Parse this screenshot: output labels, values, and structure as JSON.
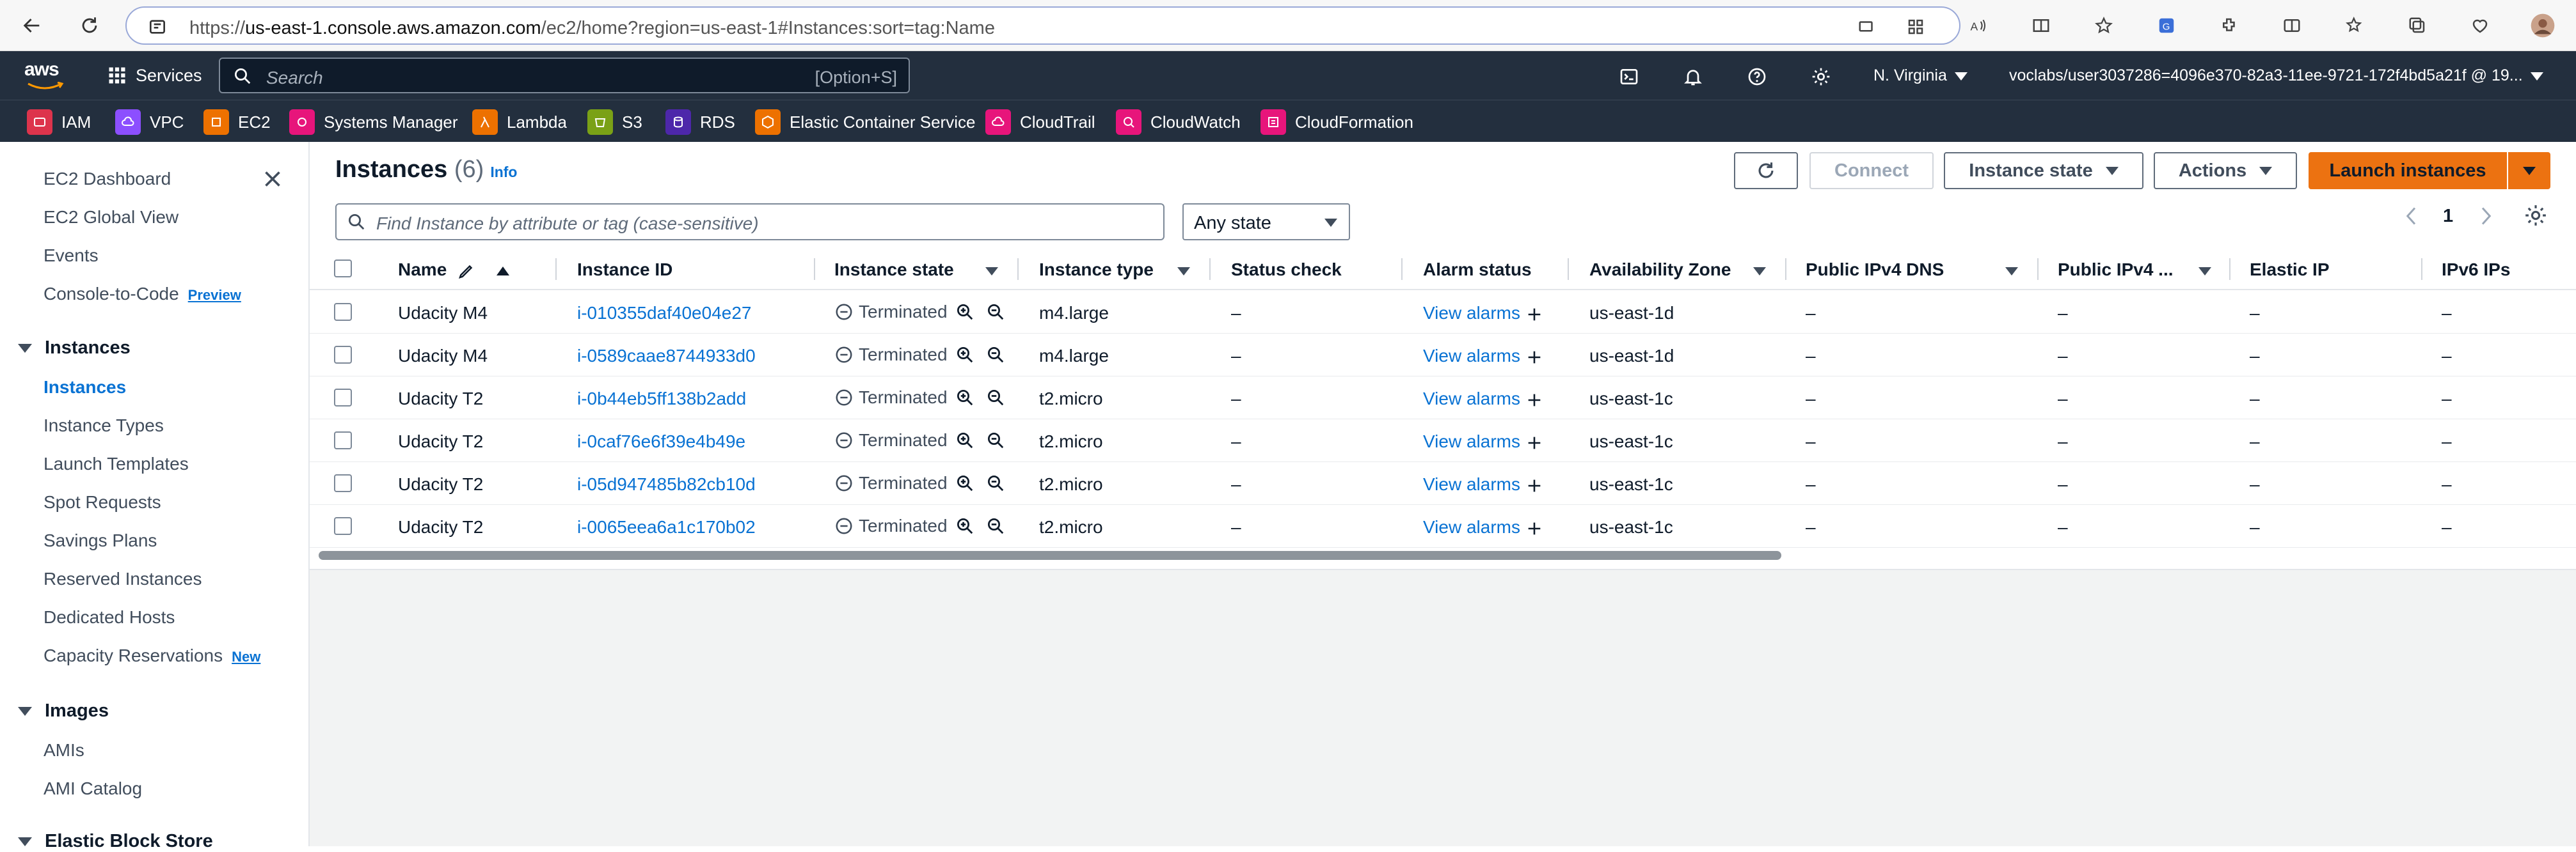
{
  "browser": {
    "url_prefix": "https://",
    "url_domain": "us-east-1.console.aws.amazon.com",
    "url_rest": "/ec2/home?region=us-east-1#Instances:sort=tag:Name"
  },
  "header": {
    "logo": "aws",
    "services_label": "Services",
    "search_placeholder": "Search",
    "search_shortcut": "[Option+S]",
    "region": "N. Virginia",
    "account": "voclabs/user3037286=4096e370-82a3-11ee-9721-172f4bd5a21f @ 19..."
  },
  "favorites": [
    {
      "label": "IAM",
      "color": "#dd344c"
    },
    {
      "label": "VPC",
      "color": "#8c4fff"
    },
    {
      "label": "EC2",
      "color": "#ed7100"
    },
    {
      "label": "Systems Manager",
      "color": "#e7157b"
    },
    {
      "label": "Lambda",
      "color": "#ed7100"
    },
    {
      "label": "S3",
      "color": "#7aa116"
    },
    {
      "label": "RDS",
      "color": "#4d27aa"
    },
    {
      "label": "Elastic Container Service",
      "color": "#ed7100"
    },
    {
      "label": "CloudTrail",
      "color": "#e7157b"
    },
    {
      "label": "CloudWatch",
      "color": "#e7157b"
    },
    {
      "label": "CloudFormation",
      "color": "#e7157b"
    }
  ],
  "sidebar": {
    "top_items": [
      "EC2 Dashboard",
      "EC2 Global View",
      "Events",
      "Console-to-Code"
    ],
    "preview_badge": "Preview",
    "instances_section": "Instances",
    "instances_items": [
      "Instances",
      "Instance Types",
      "Launch Templates",
      "Spot Requests",
      "Savings Plans",
      "Reserved Instances",
      "Dedicated Hosts",
      "Capacity Reservations"
    ],
    "new_badge": "New",
    "images_section": "Images",
    "images_items": [
      "AMIs",
      "AMI Catalog"
    ],
    "ebs_section": "Elastic Block Store"
  },
  "main": {
    "title": "Instances",
    "count": "(6)",
    "info": "Info",
    "connect": "Connect",
    "instance_state": "Instance state",
    "actions": "Actions",
    "launch": "Launch instances",
    "filter_placeholder": "Find Instance by attribute or tag (case-sensitive)",
    "state_filter": "Any state",
    "page": "1"
  },
  "table": {
    "columns": [
      "Name",
      "Instance ID",
      "Instance state",
      "Instance type",
      "Status check",
      "Alarm status",
      "Availability Zone",
      "Public IPv4 DNS",
      "Public IPv4 ...",
      "Elastic IP",
      "IPv6 IPs"
    ],
    "rows": [
      {
        "name": "Udacity M4",
        "id": "i-010355daf40e04e27",
        "state": "Terminated",
        "type": "m4.large",
        "status": "–",
        "alarm": "View alarms",
        "az": "us-east-1d",
        "dns": "–",
        "ipv4": "–",
        "eip": "–",
        "ipv6": "–"
      },
      {
        "name": "Udacity M4",
        "id": "i-0589caae8744933d0",
        "state": "Terminated",
        "type": "m4.large",
        "status": "–",
        "alarm": "View alarms",
        "az": "us-east-1d",
        "dns": "–",
        "ipv4": "–",
        "eip": "–",
        "ipv6": "–"
      },
      {
        "name": "Udacity T2",
        "id": "i-0b44eb5ff138b2add",
        "state": "Terminated",
        "type": "t2.micro",
        "status": "–",
        "alarm": "View alarms",
        "az": "us-east-1c",
        "dns": "–",
        "ipv4": "–",
        "eip": "–",
        "ipv6": "–"
      },
      {
        "name": "Udacity T2",
        "id": "i-0caf76e6f39e4b49e",
        "state": "Terminated",
        "type": "t2.micro",
        "status": "–",
        "alarm": "View alarms",
        "az": "us-east-1c",
        "dns": "–",
        "ipv4": "–",
        "eip": "–",
        "ipv6": "–"
      },
      {
        "name": "Udacity T2",
        "id": "i-05d947485b82cb10d",
        "state": "Terminated",
        "type": "t2.micro",
        "status": "–",
        "alarm": "View alarms",
        "az": "us-east-1c",
        "dns": "–",
        "ipv4": "–",
        "eip": "–",
        "ipv6": "–"
      },
      {
        "name": "Udacity T2",
        "id": "i-0065eea6a1c170b02",
        "state": "Terminated",
        "type": "t2.micro",
        "status": "–",
        "alarm": "View alarms",
        "az": "us-east-1c",
        "dns": "–",
        "ipv4": "–",
        "eip": "–",
        "ipv6": "–"
      }
    ]
  },
  "colors": {
    "aws_header": "#232f3e",
    "link": "#0972d3",
    "primary": "#ec7211"
  }
}
